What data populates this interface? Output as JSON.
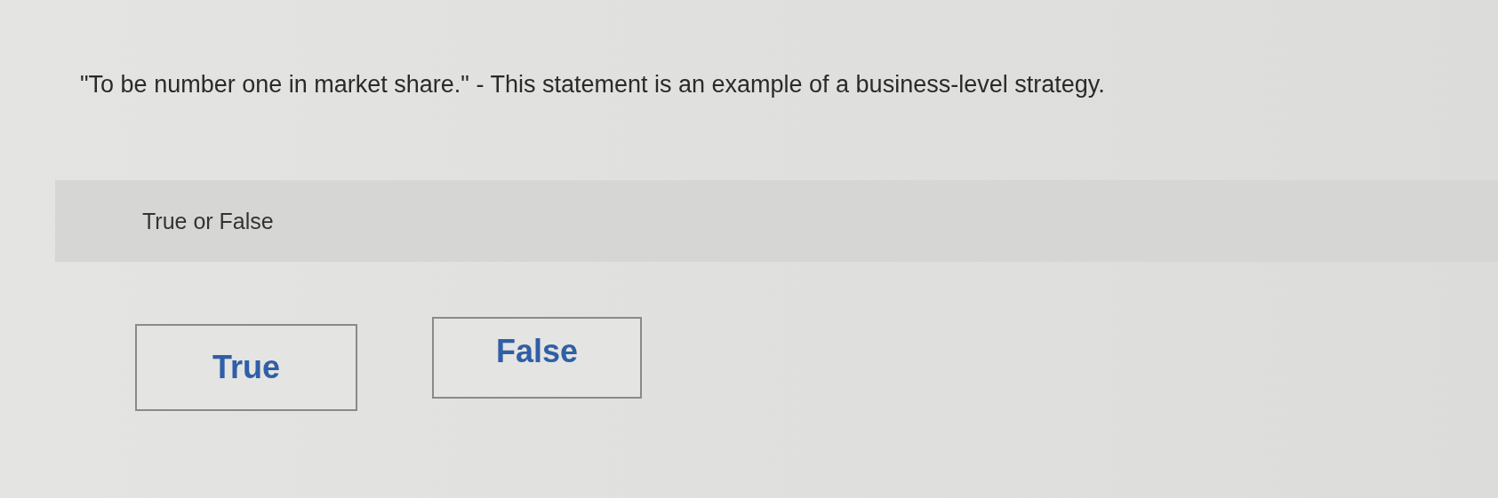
{
  "question": "\"To be number one in market share.\" - This statement is an example of a business-level strategy.",
  "prompt": "True or False",
  "options": [
    {
      "label": "True",
      "selected": false
    },
    {
      "label": "False",
      "selected": false
    }
  ]
}
